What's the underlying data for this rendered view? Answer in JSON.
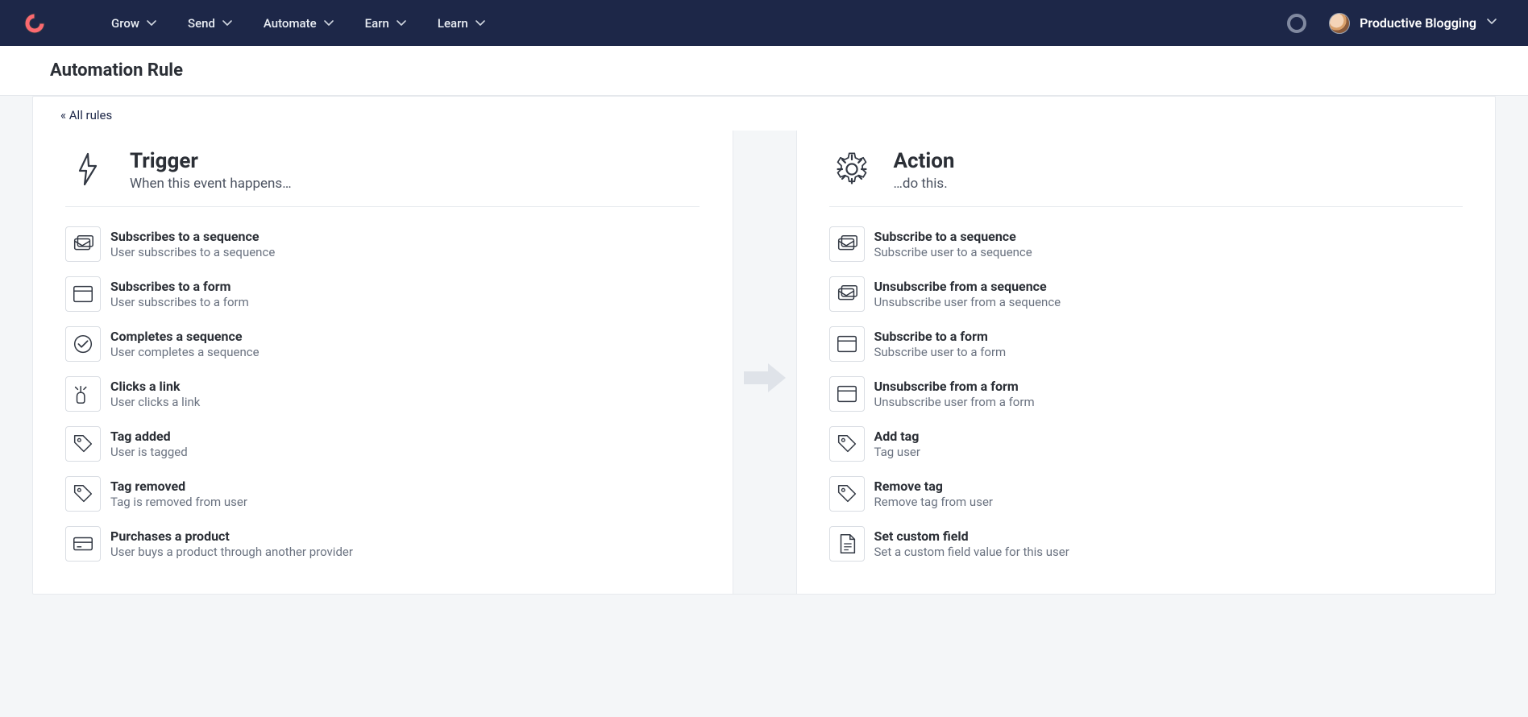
{
  "nav": {
    "items": [
      {
        "label": "Grow"
      },
      {
        "label": "Send"
      },
      {
        "label": "Automate"
      },
      {
        "label": "Earn"
      },
      {
        "label": "Learn"
      }
    ],
    "account_name": "Productive Blogging"
  },
  "page": {
    "title": "Automation Rule",
    "back_link": "« All rules"
  },
  "trigger": {
    "heading": "Trigger",
    "subheading": "When this event happens…",
    "options": [
      {
        "icon": "sequence",
        "title": "Subscribes to a sequence",
        "desc": "User subscribes to a sequence"
      },
      {
        "icon": "form",
        "title": "Subscribes to a form",
        "desc": "User subscribes to a form"
      },
      {
        "icon": "complete",
        "title": "Completes a sequence",
        "desc": "User completes a sequence"
      },
      {
        "icon": "click",
        "title": "Clicks a link",
        "desc": "User clicks a link"
      },
      {
        "icon": "tag",
        "title": "Tag added",
        "desc": "User is tagged"
      },
      {
        "icon": "tag",
        "title": "Tag removed",
        "desc": "Tag is removed from user"
      },
      {
        "icon": "card",
        "title": "Purchases a product",
        "desc": "User buys a product through another provider"
      }
    ]
  },
  "action": {
    "heading": "Action",
    "subheading": "…do this.",
    "options": [
      {
        "icon": "sequence",
        "title": "Subscribe to a sequence",
        "desc": "Subscribe user to a sequence"
      },
      {
        "icon": "sequence",
        "title": "Unsubscribe from a sequence",
        "desc": "Unsubscribe user from a sequence"
      },
      {
        "icon": "form",
        "title": "Subscribe to a form",
        "desc": "Subscribe user to a form"
      },
      {
        "icon": "form",
        "title": "Unsubscribe from a form",
        "desc": "Unsubscribe user from a form"
      },
      {
        "icon": "tag",
        "title": "Add tag",
        "desc": "Tag user"
      },
      {
        "icon": "tag",
        "title": "Remove tag",
        "desc": "Remove tag from user"
      },
      {
        "icon": "file",
        "title": "Set custom field",
        "desc": "Set a custom field value for this user"
      }
    ]
  }
}
